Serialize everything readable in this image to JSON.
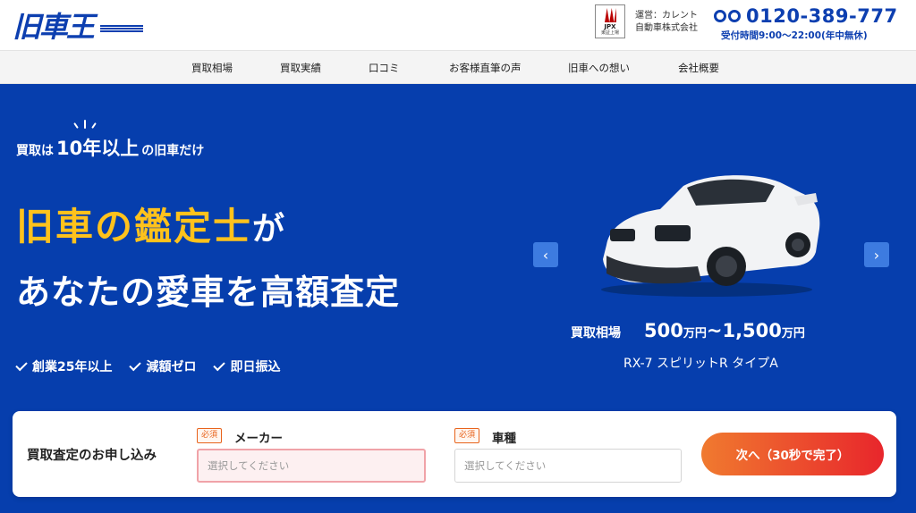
{
  "header": {
    "logo_text": "旧車王",
    "jpx": {
      "label": "JPX",
      "sub": "東証上場"
    },
    "operator_line1": "運営：カレント",
    "operator_line2": "自動車株式会社",
    "phone": "0120-389-777",
    "hours": "受付時間9:00～22:00(年中無休)"
  },
  "nav": {
    "items": [
      {
        "label": "買取相場"
      },
      {
        "label": "買取実績"
      },
      {
        "label": "口コミ"
      },
      {
        "label": "お客様直筆の声"
      },
      {
        "label": "旧車への想い"
      },
      {
        "label": "会社概要"
      }
    ]
  },
  "hero": {
    "tagline_pre": "買取は",
    "tagline_big": "10年以上",
    "tagline_post": "の旧車だけ",
    "headline_yellow": "旧車の鑑定士",
    "headline_suffix": "が",
    "headline2": "あなたの愛車を高額査定",
    "features": [
      {
        "label": "創業25年以上"
      },
      {
        "label": "減額ゼロ"
      },
      {
        "label": "即日振込"
      }
    ]
  },
  "carousel": {
    "prev_label": "‹",
    "next_label": "›",
    "price_label": "買取相場",
    "price_min": "500",
    "price_unit1": "万円",
    "price_sep": "~",
    "price_max": "1,500",
    "price_unit2": "万円",
    "model": "RX-7 スピリットR タイプA"
  },
  "form": {
    "title": "買取査定のお申し込み",
    "required_badge": "必須",
    "maker_label": "メーカー",
    "maker_placeholder": "選択してください",
    "model_label": "車種",
    "model_placeholder": "選択してください",
    "submit_label": "次へ（30秒で完了）"
  },
  "colors": {
    "brand_blue": "#063ead",
    "accent_yellow": "#ffc21c",
    "cta_orange": "#f07a2f",
    "cta_red": "#e8262c"
  }
}
